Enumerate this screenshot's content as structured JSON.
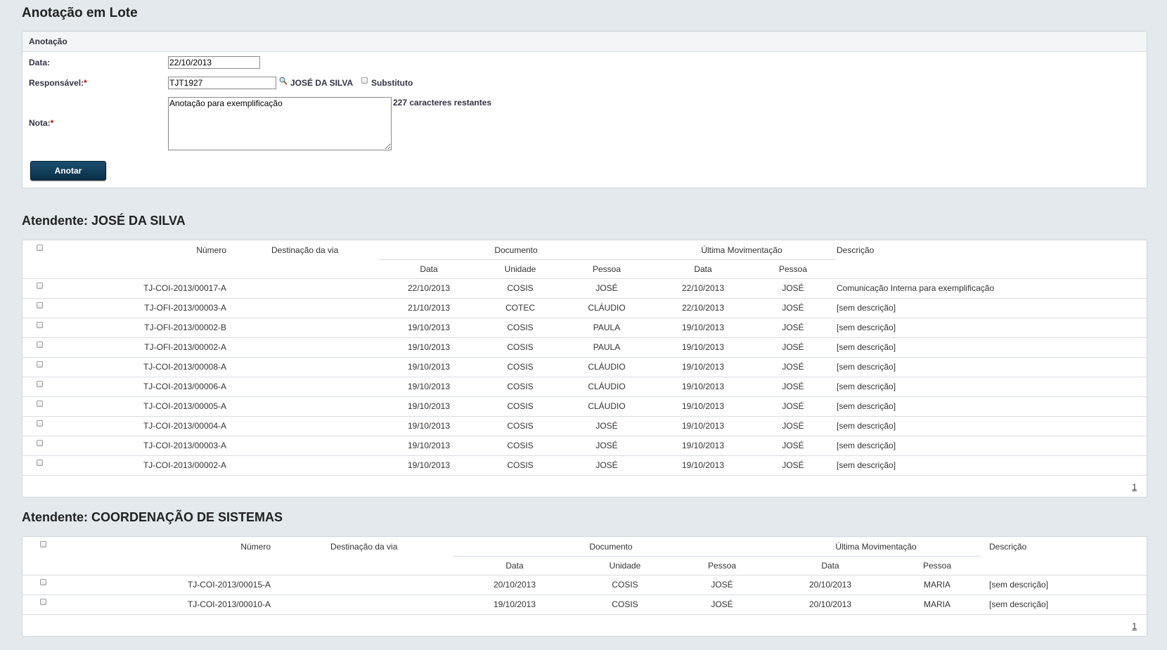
{
  "page": {
    "title": "Anotação em Lote"
  },
  "form": {
    "section_label": "Anotação",
    "data_label": "Data:",
    "data_value": "22/10/2013",
    "responsavel_label": "Responsável:",
    "responsavel_required": "*",
    "responsavel_value": "TJT1927",
    "responsavel_name": "JOSÉ DA SILVA",
    "substituto_label": "Substituto",
    "nota_label": "Nota:",
    "nota_required": "*",
    "nota_value": "Anotação para exemplificação",
    "chars_remaining": "227 caracteres restantes",
    "submit_label": "Anotar"
  },
  "tables": [
    {
      "title": "Atendente: JOSÉ DA SILVA",
      "headers": {
        "numero": "Número",
        "destinacao": "Destinação da via",
        "documento": "Documento",
        "ultima": "Última Movimentação",
        "descricao": "Descrição",
        "doc_data": "Data",
        "doc_unidade": "Unidade",
        "doc_pessoa": "Pessoa",
        "mov_data": "Data",
        "mov_pessoa": "Pessoa"
      },
      "rows": [
        [
          "TJ-COI-2013/00017-A",
          "22/10/2013",
          "COSIS",
          "JOSÉ",
          "22/10/2013",
          "JOSÉ",
          "Comunicação Interna para exemplificação"
        ],
        [
          "TJ-OFI-2013/00003-A",
          "21/10/2013",
          "COTEC",
          "CLÁUDIO",
          "22/10/2013",
          "JOSÉ",
          "[sem descrição]"
        ],
        [
          "TJ-OFI-2013/00002-B",
          "19/10/2013",
          "COSIS",
          "PAULA",
          "19/10/2013",
          "JOSÉ",
          "[sem descrição]"
        ],
        [
          "TJ-OFI-2013/00002-A",
          "19/10/2013",
          "COSIS",
          "PAULA",
          "19/10/2013",
          "JOSÉ",
          "[sem descrição]"
        ],
        [
          "TJ-COI-2013/00008-A",
          "19/10/2013",
          "COSIS",
          "CLÁUDIO",
          "19/10/2013",
          "JOSÉ",
          "[sem descrição]"
        ],
        [
          "TJ-COI-2013/00006-A",
          "19/10/2013",
          "COSIS",
          "CLÁUDIO",
          "19/10/2013",
          "JOSÉ",
          "[sem descrição]"
        ],
        [
          "TJ-COI-2013/00005-A",
          "19/10/2013",
          "COSIS",
          "CLÁUDIO",
          "19/10/2013",
          "JOSÉ",
          "[sem descrição]"
        ],
        [
          "TJ-COI-2013/00004-A",
          "19/10/2013",
          "COSIS",
          "JOSÉ",
          "19/10/2013",
          "JOSÉ",
          "[sem descrição]"
        ],
        [
          "TJ-COI-2013/00003-A",
          "19/10/2013",
          "COSIS",
          "JOSÉ",
          "19/10/2013",
          "JOSÉ",
          "[sem descrição]"
        ],
        [
          "TJ-COI-2013/00002-A",
          "19/10/2013",
          "COSIS",
          "JOSÉ",
          "19/10/2013",
          "JOSÉ",
          "[sem descrição]"
        ]
      ],
      "pager": "1"
    },
    {
      "title": "Atendente: COORDENAÇÃO DE SISTEMAS",
      "headers": {
        "numero": "Número",
        "destinacao": "Destinação da via",
        "documento": "Documento",
        "ultima": "Última Movimentação",
        "descricao": "Descrição",
        "doc_data": "Data",
        "doc_unidade": "Unidade",
        "doc_pessoa": "Pessoa",
        "mov_data": "Data",
        "mov_pessoa": "Pessoa"
      },
      "rows": [
        [
          "TJ-COI-2013/00015-A",
          "20/10/2013",
          "COSIS",
          "JOSÉ",
          "20/10/2013",
          "MARIA",
          "[sem descrição]"
        ],
        [
          "TJ-COI-2013/00010-A",
          "19/10/2013",
          "COSIS",
          "JOSÉ",
          "20/10/2013",
          "MARIA",
          "[sem descrição]"
        ]
      ],
      "pager": "1"
    }
  ]
}
